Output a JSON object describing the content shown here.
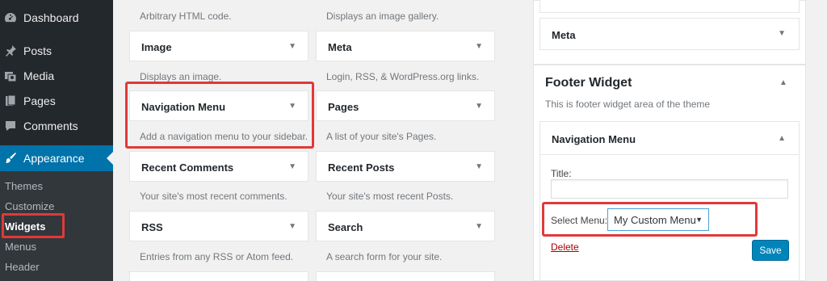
{
  "sidebar": {
    "menu": [
      {
        "label": "Dashboard",
        "icon": "dashboard-icon"
      },
      {
        "label": "Posts",
        "icon": "pin-icon"
      },
      {
        "label": "Media",
        "icon": "media-icon"
      },
      {
        "label": "Pages",
        "icon": "pages-icon"
      },
      {
        "label": "Comments",
        "icon": "comment-icon"
      },
      {
        "label": "Appearance",
        "icon": "paintbrush-icon"
      }
    ],
    "submenu": [
      "Themes",
      "Customize",
      "Widgets",
      "Menus",
      "Header"
    ]
  },
  "available_widgets": {
    "col1_top_desc": "Arbitrary HTML code.",
    "col2_top_desc": "Displays an image gallery.",
    "tiles": [
      {
        "title": "Image",
        "desc": "Displays an image."
      },
      {
        "title": "Meta",
        "desc": "Login, RSS, & WordPress.org links."
      },
      {
        "title": "Navigation Menu",
        "desc": "Add a navigation menu to your sidebar."
      },
      {
        "title": "Pages",
        "desc": "A list of your site's Pages."
      },
      {
        "title": "Recent Comments",
        "desc": "Your site's most recent comments."
      },
      {
        "title": "Recent Posts",
        "desc": "Your site's most recent Posts."
      },
      {
        "title": "RSS",
        "desc": "Entries from any RSS or Atom feed."
      },
      {
        "title": "Search",
        "desc": "A search form for your site."
      }
    ]
  },
  "meta_widget": {
    "title": "Meta"
  },
  "footer_widget": {
    "title": "Footer Widget",
    "desc": "This is footer widget area of the theme",
    "nav_widget": {
      "title": "Navigation Menu",
      "title_label": "Title:",
      "title_value": "",
      "select_label": "Select Menu:",
      "select_value": "My Custom Menu",
      "delete_label": "Delete",
      "save_label": "Save"
    }
  },
  "colors": {
    "accent": "#0073aa",
    "highlight": "#e0393a",
    "sidebar": "#23282d"
  }
}
